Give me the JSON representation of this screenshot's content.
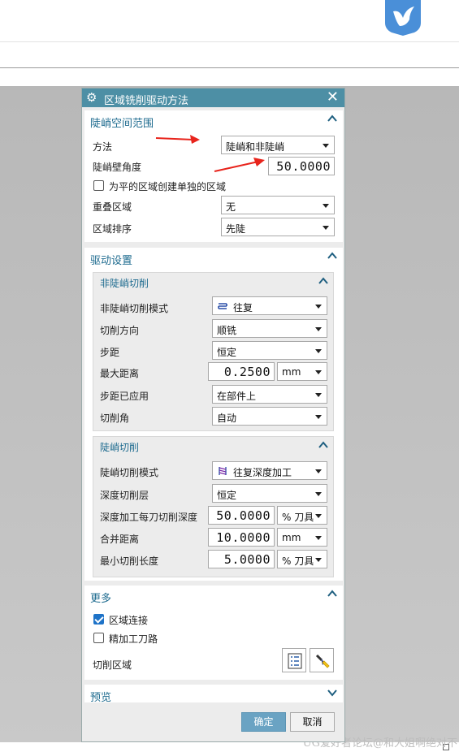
{
  "dialog": {
    "title": "区域铣削驱动方法",
    "steep": {
      "header": "陡峭空间范围",
      "method_label": "方法",
      "method_value": "陡峭和非陡峭",
      "angle_label": "陡峭壁角度",
      "angle_value": "50.0000",
      "flat_checkbox_label": "为平的区域创建单独的区域",
      "overlap_label": "重叠区域",
      "overlap_value": "无",
      "order_label": "区域排序",
      "order_value": "先陡"
    },
    "drive": {
      "header": "驱动设置",
      "nonsteep": {
        "header": "非陡峭切削",
        "mode_label": "非陡峭切削模式",
        "mode_value": "往复",
        "direction_label": "切削方向",
        "direction_value": "顺铣",
        "stepover_label": "步距",
        "stepover_value": "恒定",
        "maxdist_label": "最大距离",
        "maxdist_value": "0.2500",
        "maxdist_unit": "mm",
        "applied_label": "步距已应用",
        "applied_value": "在部件上",
        "angle_label": "切削角",
        "angle_value": "自动"
      },
      "steepcut": {
        "header": "陡峭切削",
        "mode_label": "陡峭切削模式",
        "mode_value": "往复深度加工",
        "level_label": "深度切削层",
        "level_value": "恒定",
        "depth_label": "深度加工每刀切削深度",
        "depth_value": "50.0000",
        "depth_unit": "% 刀具",
        "merge_label": "合并距离",
        "merge_value": "10.0000",
        "merge_unit": "mm",
        "minlen_label": "最小切削长度",
        "minlen_value": "5.0000",
        "minlen_unit": "% 刀具"
      }
    },
    "more": {
      "header": "更多",
      "connect_label": "区域连接",
      "finish_label": "精加工刀路",
      "cut_region_label": "切削区域"
    },
    "preview": {
      "header": "预览"
    },
    "ok_label": "确定",
    "cancel_label": "取消"
  },
  "watermark": "UG爱好者论坛@和大姐啊绝对不",
  "colors": {
    "title_bar": "#4d8fa5",
    "section_header": "#1e6b8f",
    "ok_button": "#6aa3c3",
    "arrow": "#e8241c"
  }
}
